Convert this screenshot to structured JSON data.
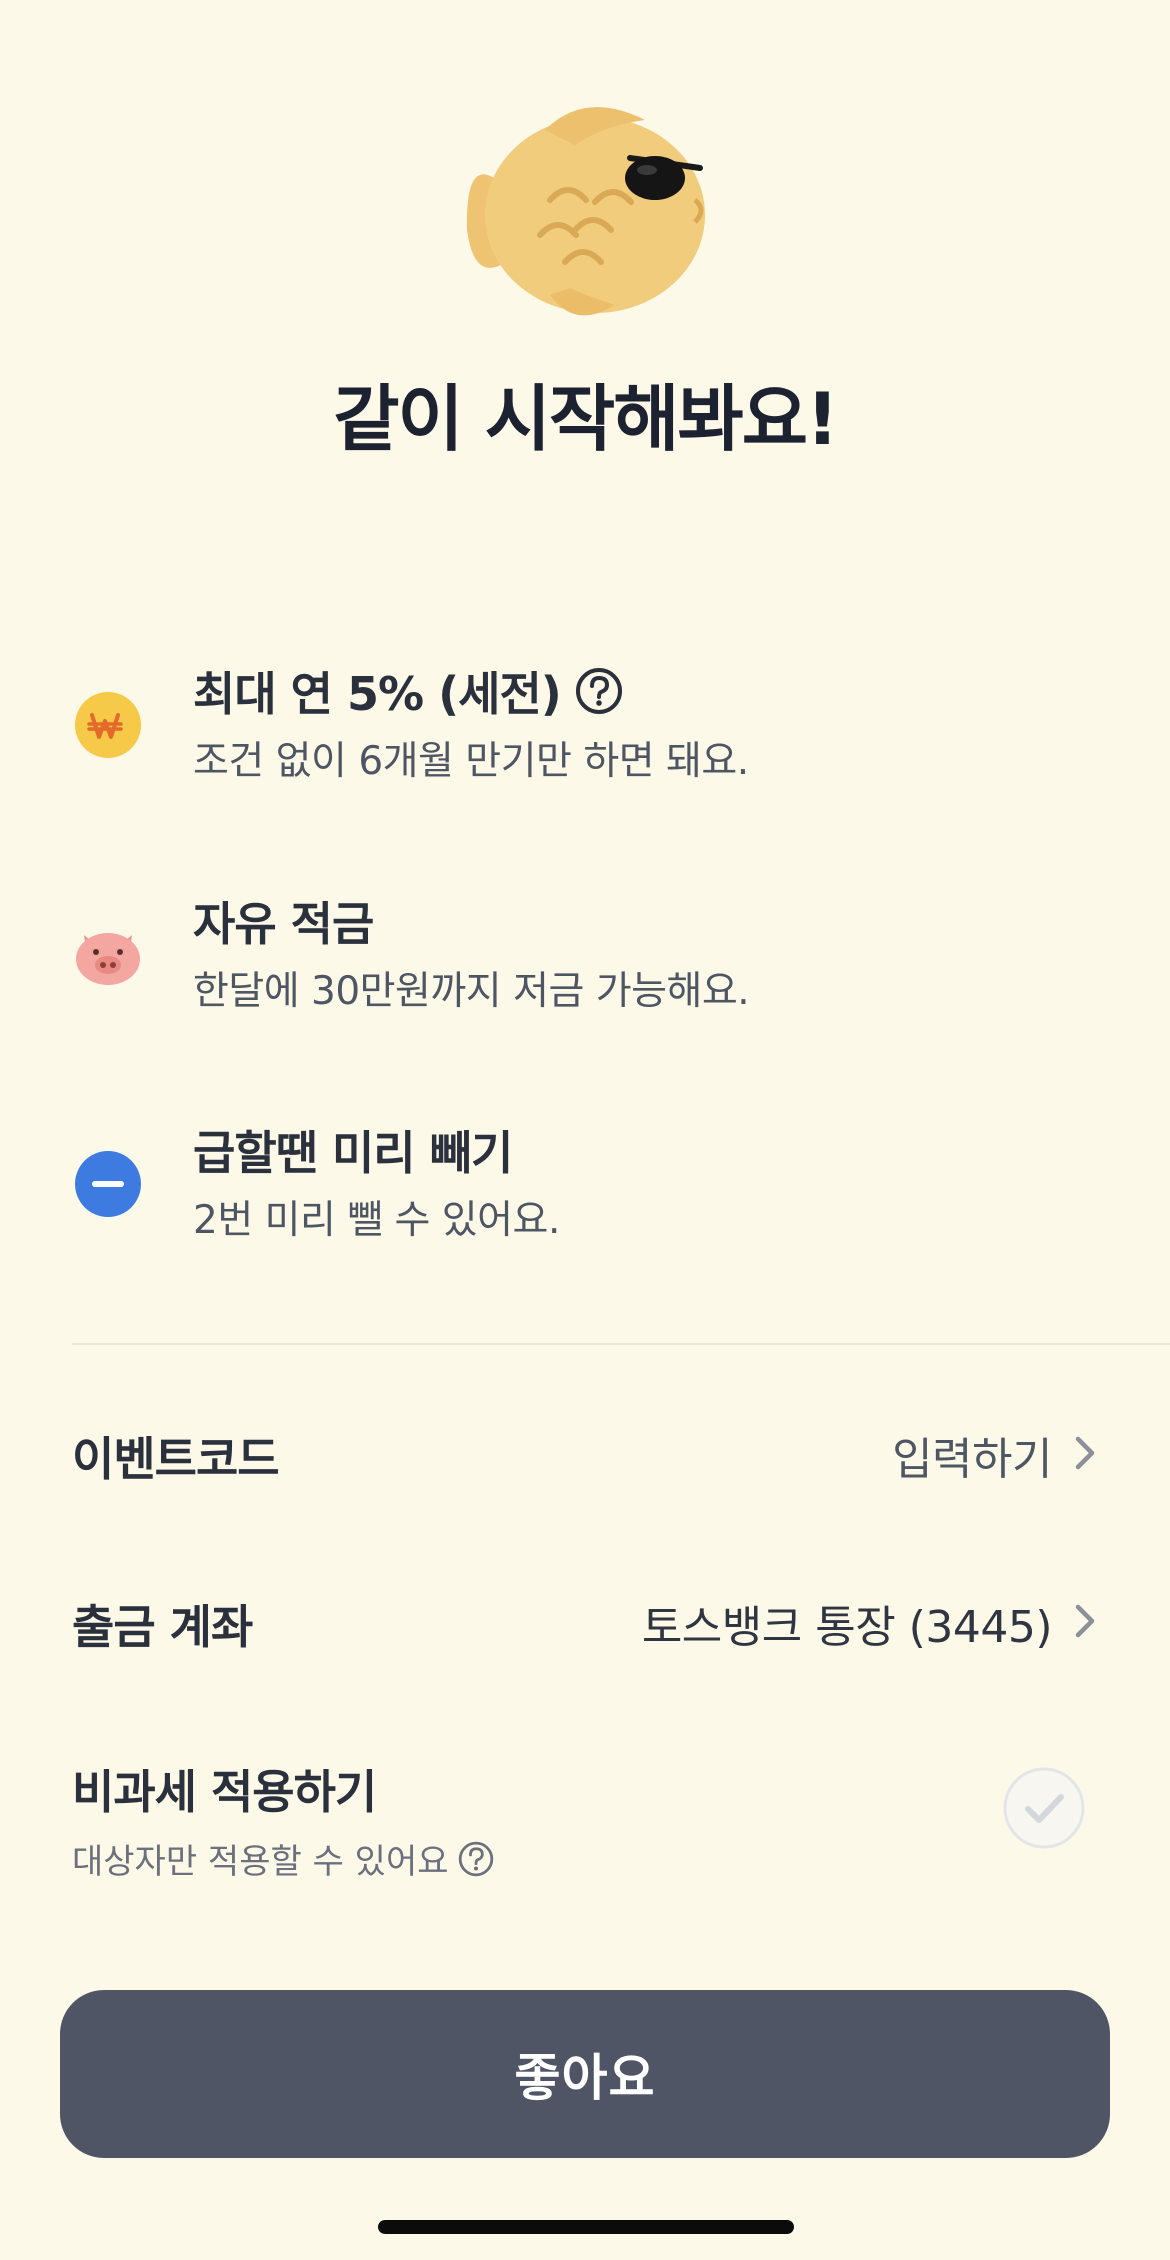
{
  "header": {
    "mascot_icon": "taiyaki-fish-with-sunglasses-icon",
    "title": "같이 시작해봐요!"
  },
  "features": [
    {
      "icon": "won-coin-icon",
      "title": "최대 연 5% (세전)",
      "has_help": true,
      "description": "조건 없이 6개월 만기만 하면 돼요."
    },
    {
      "icon": "piggy-icon",
      "title": "자유 적금",
      "has_help": false,
      "description": "한달에 30만원까지 저금 가능해요."
    },
    {
      "icon": "minus-circle-icon",
      "title": "급할땐 미리 빼기",
      "has_help": false,
      "description": "2번 미리 뺄 수 있어요."
    }
  ],
  "settings": {
    "event_code": {
      "label": "이벤트코드",
      "value": "입력하기"
    },
    "withdraw_account": {
      "label": "출금 계좌",
      "value": "토스뱅크 통장 (3445)"
    },
    "tax_free": {
      "label": "비과세 적용하기",
      "sublabel": "대상자만 적용할 수 있어요",
      "checked": false
    }
  },
  "cta": {
    "label": "좋아요"
  },
  "colors": {
    "background": "#fdf9e9",
    "cta": "#4f5564",
    "coin": "#f7c948",
    "pig": "#f4a7a0",
    "minus": "#3d7be0"
  }
}
